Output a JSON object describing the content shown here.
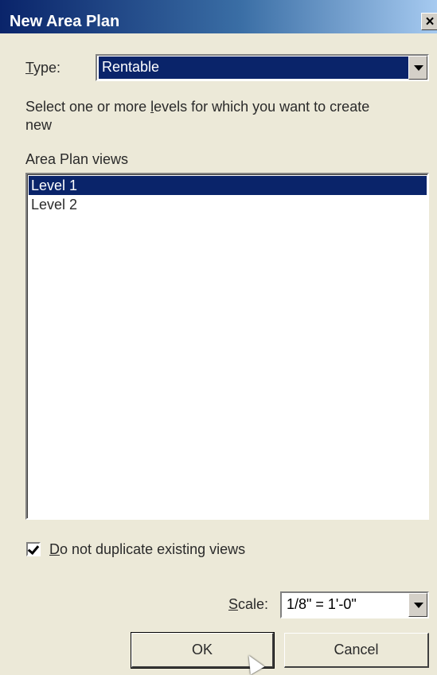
{
  "window": {
    "title": "New Area Plan",
    "close_glyph": "×"
  },
  "type_field": {
    "label_mnemonic": "T",
    "label_rest": "ype:",
    "selected_value": "Rentable"
  },
  "instructions": {
    "line1_pre": "Select one or more ",
    "line1_mnemonic": "l",
    "line1_post": "evels for which you want to create",
    "line2": "new"
  },
  "views_list": {
    "label": "Area Plan views",
    "items": [
      {
        "label": "Level 1",
        "selected": true
      },
      {
        "label": "Level 2",
        "selected": false
      }
    ]
  },
  "duplicate_checkbox": {
    "checked": true,
    "label_mnemonic": "D",
    "label_rest": "o not duplicate existing views"
  },
  "scale_field": {
    "label_mnemonic": "S",
    "label_rest": "cale:",
    "selected_value": "1/8\" = 1'-0\""
  },
  "buttons": {
    "ok": "OK",
    "cancel": "Cancel"
  },
  "colors": {
    "selection": "#0a246a",
    "dialog_bg": "#ece9d8"
  }
}
